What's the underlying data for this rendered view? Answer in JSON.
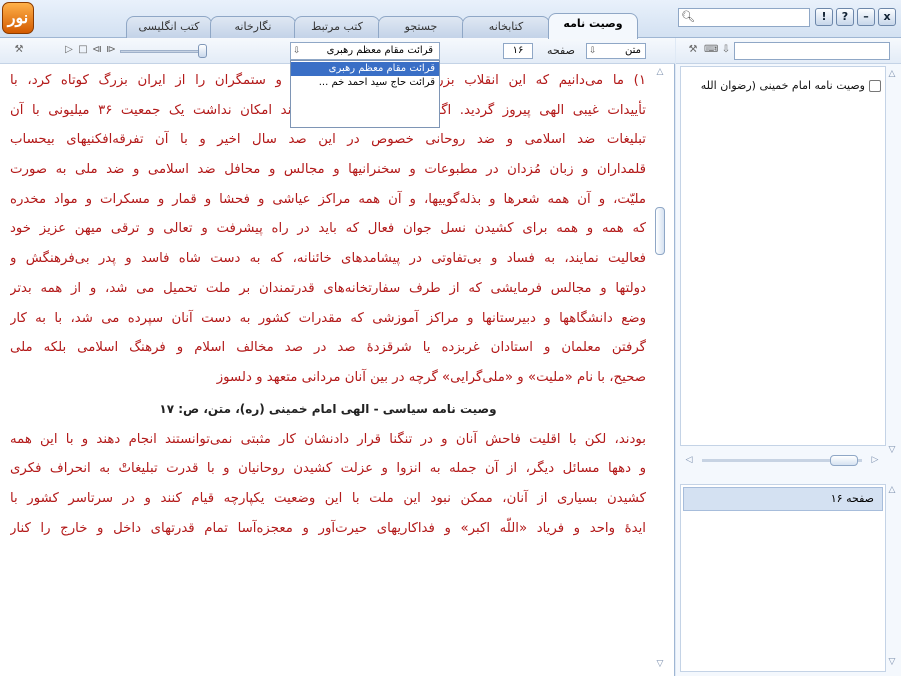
{
  "app": {
    "logo_text": "نور"
  },
  "tabs": [
    {
      "label": "وصیت نامه",
      "active": true
    },
    {
      "label": "کتابخانه",
      "active": false
    },
    {
      "label": "جستجو",
      "active": false
    },
    {
      "label": "کتب مرتبط",
      "active": false
    },
    {
      "label": "نگارخانه",
      "active": false
    },
    {
      "label": "کتب انگلیسی",
      "active": false
    }
  ],
  "window_buttons": {
    "close": "x",
    "minimize": "–",
    "help": "?",
    "info": "!"
  },
  "search": {
    "value": "",
    "placeholder": ""
  },
  "toolbar": {
    "recitation_selected": "قرائت مقام معظم رهبری",
    "recitation_options": [
      "قرائت مقام معظم رهبری",
      "قرائت حاج سید احمد خم ..."
    ],
    "page_number": "۱۶",
    "page_label": "صفحه",
    "section_selected": "متن"
  },
  "document": {
    "paragraph1": [
      "۱) ما می‌دانیم که این انقلاب بزرگ که دست جهانخواران و ستمگران را از ایران بزرگ کوتاه کرد، با",
      "تأییدات غیبی الهی پیروز گردید. اگر نبود دست توانای خداوند امکان نداشت یک جمعیت ۳۶ میلیونی با آن",
      "تبلیغات ضد اسلامی و ضد روحانی خصوص در این صد سال اخیر و با آن تفرقه‌افکنیهای بیحساب",
      "قلمداران و زبان مُزدان در مطبوعات و سخنرانیها و مجالس و محافل ضد اسلامی و ضد ملی به صورت",
      "ملیّت، و آن همه شعرها و بذله‌گوییها، و آن همه مراکز عیاشی و فحشا و قمار و مسکرات و مواد مخدره",
      "که همه و همه برای کشیدن نسل جوان فعال که باید در راه پیشرفت و تعالی و ترقی میهن عزیز خود",
      "فعالیت نمایند، به فساد و بی‌تفاوتی در پیشامدهای خائنانه، که به دست شاه فاسد و پدر بی‌فرهنگش و",
      "دولتها و مجالس فرمایشی که از طرف سفارتخانه‌های قدرتمندان بر ملت تحمیل می شد، و از همه بدتر",
      "وضع دانشگاهها و دبیرستانها و مراکز آموزشی که مقدرات کشور به دست آنان سپرده می شد، با به کار",
      "گرفتن معلمان و استادان غربزده یا شرقزدۀ صد در صد مخالف اسلام و فرهنگ اسلامی بلکه ملی",
      "صحیح، با نام «ملیت» و «ملی‌گرایی» گرچه در بین آنان مردانی متعهد و دلسوز"
    ],
    "footer": "وصیت نامه سیاسی - الهی امام خمینی (ره)، متن، ص: ۱۷",
    "paragraph2": [
      "بودند، لکن با اقلیت فاحش آنان و در تنگنا قرار دادنشان کار مثبتی نمی‌توانستند انجام دهند و با این همه",
      "و دهها مسائل دیگر، از آن جمله به انزوا و عزلت کشیدن روحانیان و با قدرت تبلیغاتْ به انحراف فکری",
      "کشیدن بسیاری از آنان، ممکن نبود این ملت با این وضعیت یکپارچه قیام کنند و در سرتاسر کشور با",
      "ایدۀ واحد و فریاد «اللّه اکبر» و فداکاریهای حیرت‌آور و معجزه‌آسا تمام قدرتهای داخل و خارج را کنار"
    ]
  },
  "sidebar": {
    "tree_item": "وصیت نامه امام خمینی (رضوان الله",
    "bookmark_item": "صفحه ۱۶"
  }
}
